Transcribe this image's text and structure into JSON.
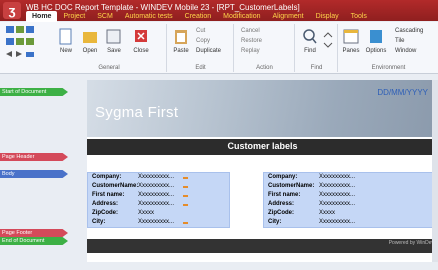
{
  "window": {
    "title": "WB HC DOC Report Template - WINDEV Mobile 23 - [RPT_CustomerLabels]",
    "logo_glyph": "ʒ"
  },
  "menu": {
    "tabs": [
      "Home",
      "Project",
      "SCM",
      "Automatic tests",
      "Creation",
      "Modification",
      "Alignment",
      "Display",
      "Tools"
    ],
    "active": "Home"
  },
  "ribbon": {
    "new_label": "New",
    "open_label": "Open",
    "save_label": "Save",
    "close_label": "Close",
    "paste_label": "Paste",
    "cut_label": "Cut",
    "copy_label": "Copy",
    "duplicate_label": "Duplicate",
    "cancel_label": "Cancel",
    "restore_label": "Restore",
    "replay_label": "Replay",
    "find_label": "Find",
    "panes_label": "Panes",
    "options_label": "Options",
    "cascading_label": "Cascading",
    "tile_label": "Tile",
    "window_label": "Window",
    "group_general": "General",
    "group_edit": "Edit",
    "group_action": "Action",
    "group_find": "Find",
    "group_environment": "Environment"
  },
  "bands": {
    "start_of_document": "Start of Document",
    "page_header": "Page Header",
    "body": "Body",
    "page_footer": "Page Footer",
    "end_of_document": "End of Document"
  },
  "report": {
    "title": "Sygma First",
    "date": "DD/MM/YYYY",
    "customer_labels": "Customer labels",
    "powered_by": "Powered by WinDev"
  },
  "label_left": {
    "company": "Company:",
    "customer_name": "CustomerName:",
    "first_name": "First name:",
    "address": "Address:",
    "zipcode": "ZipCode:",
    "city": "City:",
    "company_val": "Xxxxxxxxxx...",
    "customer_name_val": "Xxxxxxxxxx...",
    "first_name_val": "Xxxxxxxxxx...",
    "address_val": "Xxxxxxxxxx...",
    "zipcode_val": "Xxxxx",
    "city_val": "Xxxxxxxxxx..."
  },
  "label_right": {
    "company": "Company:",
    "customer_name": "CustomerName:",
    "first_name": "First name:",
    "address": "Address:",
    "zipcode": "ZipCode:",
    "city": "City:",
    "company_val": "Xxxxxxxxxx...",
    "customer_name_val": "Xxxxxxxxxx...",
    "first_name_val": "Xxxxxxxxxx...",
    "address_val": "Xxxxxxxxxx...",
    "zipcode_val": "Xxxxx",
    "city_val": "Xxxxxxxxxx..."
  },
  "colors": {
    "brand_red": "#b22a2a",
    "accent_yellow": "#ffd54a",
    "band_green": "#3db045",
    "band_red": "#d44a5a",
    "band_blue": "#4a72c9",
    "label_bg": "#c5d7f6",
    "date_blue": "#2e5fb7"
  }
}
